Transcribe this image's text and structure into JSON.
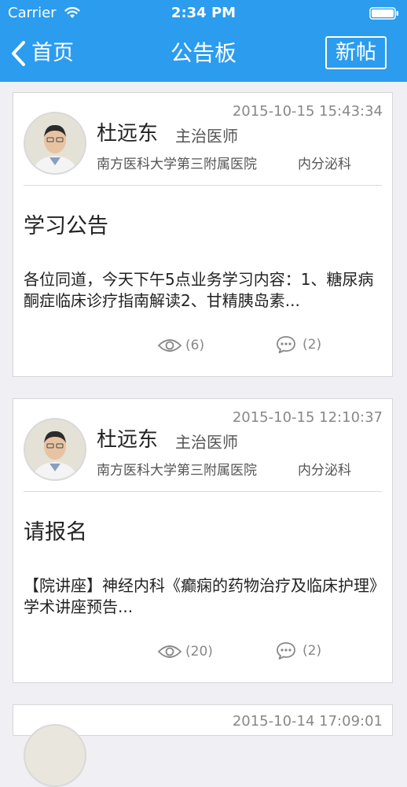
{
  "status_bar": {
    "carrier": "Carrier",
    "time": "2:34 PM",
    "wifi_icon": "wifi-icon",
    "battery_icon": "battery-icon"
  },
  "nav": {
    "back_label": "首页",
    "title": "公告板",
    "new_post_label": "新帖",
    "background_color": "#2b9cee"
  },
  "posts": [
    {
      "timestamp": "2015-10-15 15:43:34",
      "author_name": "杜远东",
      "author_title": "主治医师",
      "hospital": "南方医科大学第三附属医院",
      "department": "内分泌科",
      "title": "学习公告",
      "excerpt": "各位同道，今天下午5点业务学习内容：1、糖尿病酮症临床诊疗指南解读2、甘精胰岛素...",
      "views": "(6)",
      "comments": "(2)"
    },
    {
      "timestamp": "2015-10-15 12:10:37",
      "author_name": "杜远东",
      "author_title": "主治医师",
      "hospital": "南方医科大学第三附属医院",
      "department": "内分泌科",
      "title": "请报名",
      "excerpt": "【院讲座】神经内科《癫痫的药物治疗及临床护理》学术讲座预告...",
      "views": "(20)",
      "comments": "(2)"
    },
    {
      "timestamp": "2015-10-14 17:09:01"
    }
  ]
}
